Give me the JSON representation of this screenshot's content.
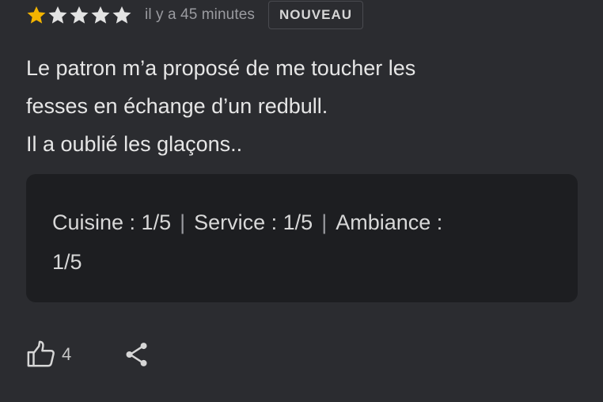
{
  "review": {
    "rating_value": 1,
    "rating_max": 5,
    "timestamp": "il y a 45 minutes",
    "badge": "NOUVEAU",
    "text_lines": [
      "Le patron m’a proposé de me toucher les",
      "fesses en échange d’un redbull.",
      "Il a oublié les glaçons.."
    ],
    "sub_ratings": {
      "line1": {
        "cuisine": "Cuisine : 1/5",
        "service": "Service : 1/5",
        "ambiance": "Ambiance :"
      },
      "line2": "1/5",
      "separator": "|"
    },
    "actions": {
      "like_icon": "thumbs-up-icon",
      "like_count": "4",
      "share_icon": "share-icon"
    },
    "colors": {
      "star_filled": "#f4b400",
      "star_empty": "#e3e3e3",
      "background": "#2b2c30",
      "box_background": "#1d1e21"
    }
  }
}
